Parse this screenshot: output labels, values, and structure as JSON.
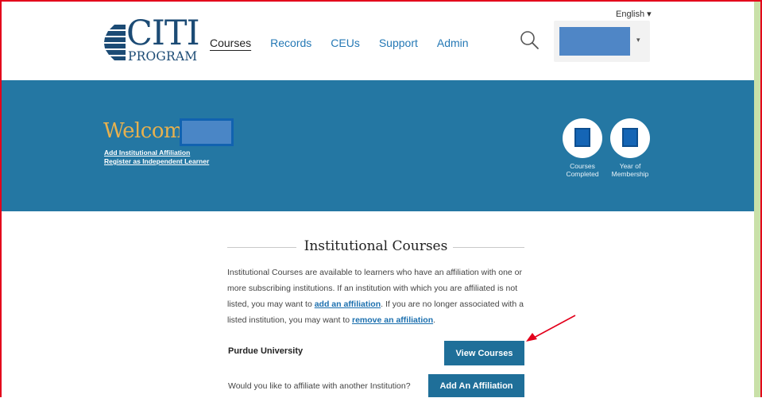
{
  "header": {
    "logo": {
      "name": "CITI",
      "subtitle": "PROGRAM"
    },
    "nav": [
      {
        "label": "Courses",
        "active": true
      },
      {
        "label": "Records"
      },
      {
        "label": "CEUs"
      },
      {
        "label": "Support"
      },
      {
        "label": "Admin"
      }
    ],
    "language": "English ▾",
    "search_icon": "search-icon",
    "user_caret": "▾"
  },
  "banner": {
    "welcome": "Welcome,",
    "links": {
      "add_affiliation": "Add Institutional Affiliation",
      "register_independent": "Register as Independent Learner"
    },
    "stats": [
      {
        "label_line1": "Courses",
        "label_line2": "Completed"
      },
      {
        "label_line1": "Year of",
        "label_line2": "Membership"
      }
    ]
  },
  "content": {
    "title": "Institutional Courses",
    "description": {
      "part1": "Institutional Courses are available to learners who have an affiliation with one or more subscribing institutions. If an institution with which you are affiliated is not listed, you may want to ",
      "link1": "add an affiliation",
      "part2": ". If you are no longer associated with a listed institution, you may want to ",
      "link2": "remove an affiliation",
      "part3": "."
    },
    "institution": "Purdue University",
    "view_courses_label": "View Courses",
    "affiliate_question": "Would you like to affiliate with another Institution?",
    "add_affiliation_label": "Add An Affiliation"
  },
  "colors": {
    "banner": "#2477a3",
    "button": "#1f6f99",
    "welcome": "#e7b14e",
    "frame": "#e3001b",
    "arrow": "#e3001b"
  }
}
